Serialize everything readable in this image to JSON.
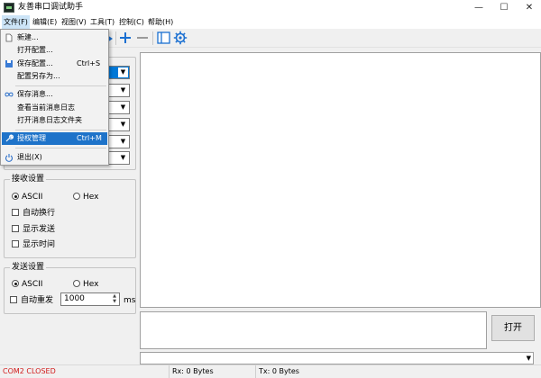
{
  "window": {
    "title": "友善串口调试助手",
    "minimize": "—",
    "maximize": "☐",
    "close": "✕"
  },
  "menubar": {
    "items": [
      "文件(F)",
      "编辑(E)",
      "视图(V)",
      "工具(T)",
      "控制(C)",
      "帮助(H)"
    ]
  },
  "file_menu": {
    "items": [
      {
        "label": "新建...",
        "shortcut": "",
        "icon": "new-file-icon"
      },
      {
        "label": "打开配置...",
        "shortcut": "",
        "icon": ""
      },
      {
        "label": "保存配置...",
        "shortcut": "Ctrl+S",
        "icon": "save-icon"
      },
      {
        "label": "配置另存为...",
        "shortcut": "",
        "icon": ""
      },
      {
        "label": "保存消息...",
        "shortcut": "",
        "icon": "infinity-icon"
      },
      {
        "label": "查看当前消息日志",
        "shortcut": "",
        "icon": ""
      },
      {
        "label": "打开消息日志文件夹",
        "shortcut": "",
        "icon": ""
      },
      {
        "label": "授权管理",
        "shortcut": "Ctrl+M",
        "icon": "wrench-icon"
      },
      {
        "label": "退出(X)",
        "shortcut": "",
        "icon": "power-icon"
      }
    ]
  },
  "receive_settings": {
    "title": "接收设置",
    "ascii": "ASCII",
    "hex": "Hex",
    "selected": "ASCII",
    "options": [
      "自动换行",
      "显示发送",
      "显示时间"
    ]
  },
  "send_settings": {
    "title": "发送设置",
    "ascii": "ASCII",
    "hex": "Hex",
    "selected": "ASCII",
    "auto_resend": "自动重发",
    "interval": "1000",
    "unit": "ms"
  },
  "open_button": "打开",
  "status": {
    "port": "COM2 CLOSED",
    "rx": "Rx: 0 Bytes",
    "tx": "Tx: 0 Bytes",
    "port_color": "#d11a1a"
  },
  "colors": {
    "highlight": "#1e73c9",
    "toolbar_icon": "#1a6fd1"
  }
}
